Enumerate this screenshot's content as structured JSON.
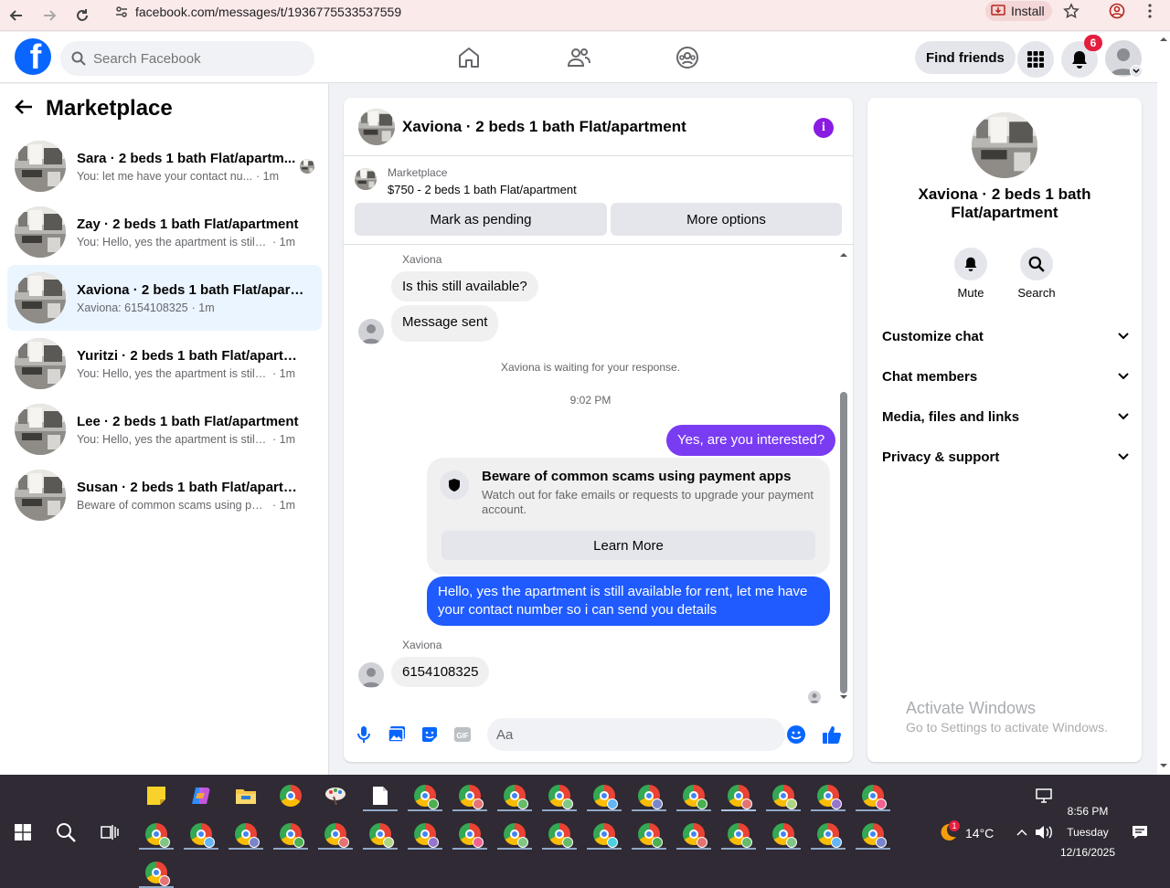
{
  "browser": {
    "url": "facebook.com/messages/t/1936775533537559",
    "install_label": "Install"
  },
  "fb_nav": {
    "search_placeholder": "Search Facebook",
    "find_friends": "Find friends",
    "notification_count": "6"
  },
  "left_panel": {
    "title": "Marketplace",
    "conversations": [
      {
        "name": "Sara · 2 beds 1 bath Flat/apartm...",
        "preview": "You: let me have your contact nu...",
        "time": "· 1m",
        "active": false
      },
      {
        "name": "Zay · 2 beds 1 bath Flat/apartment",
        "preview": "You: Hello, yes the apartment is still a...",
        "time": "· 1m",
        "active": false
      },
      {
        "name": "Xaviona · 2 beds 1 bath Flat/apart...",
        "preview": "Xaviona: 6154108325",
        "time": "· 1m",
        "active": true
      },
      {
        "name": "Yuritzi · 2 beds 1 bath Flat/apartm...",
        "preview": "You: Hello, yes the apartment is still a...",
        "time": "· 1m",
        "active": false
      },
      {
        "name": "Lee · 2 beds 1 bath Flat/apartment",
        "preview": "You: Hello, yes the apartment is still a...",
        "time": "· 1m",
        "active": false
      },
      {
        "name": "Susan · 2 beds 1 bath Flat/apartme...",
        "preview": "Beware of common scams using pay...",
        "time": "· 1m",
        "active": false
      }
    ]
  },
  "chat": {
    "title": "Xaviona · 2 beds 1 bath Flat/apartment",
    "marketplace_label": "Marketplace",
    "listing": "$750 - 2 beds 1 bath Flat/apartment",
    "mark_pending": "Mark as pending",
    "more_options": "More options",
    "sender1": "Xaviona",
    "msg1": "Is this still available?",
    "msg2": "Message sent",
    "waiting": "Xaviona is waiting for your response.",
    "timestamp": "9:02 PM",
    "msg3": "Yes, are you interested?",
    "warning_title": "Beware of common scams using payment apps",
    "warning_body": "Watch out for fake emails or requests to upgrade your payment account.",
    "learn_more": "Learn More",
    "msg4": "Hello, yes the apartment is still available for rent, let me have your contact number so i can send you details",
    "sender2": "Xaviona",
    "msg5": "6154108325",
    "composer_placeholder": "Aa"
  },
  "right_panel": {
    "title": "Xaviona · 2 beds 1 bath Flat/apartment",
    "mute": "Mute",
    "search": "Search",
    "sections": [
      "Customize chat",
      "Chat members",
      "Media, files and links",
      "Privacy & support"
    ],
    "activate_title": "Activate Windows",
    "activate_sub": "Go to Settings to activate Windows."
  },
  "taskbar": {
    "weather": "14°C",
    "weather_badge": "1",
    "time": "8:56 PM",
    "day": "Tuesday",
    "date": "12/16/2025"
  },
  "colors": {
    "fb_blue": "#0866ff",
    "outgoing_purple": "#7a3cf2",
    "outgoing_blue": "#1f5bff",
    "active_conv": "#ebf5ff"
  }
}
